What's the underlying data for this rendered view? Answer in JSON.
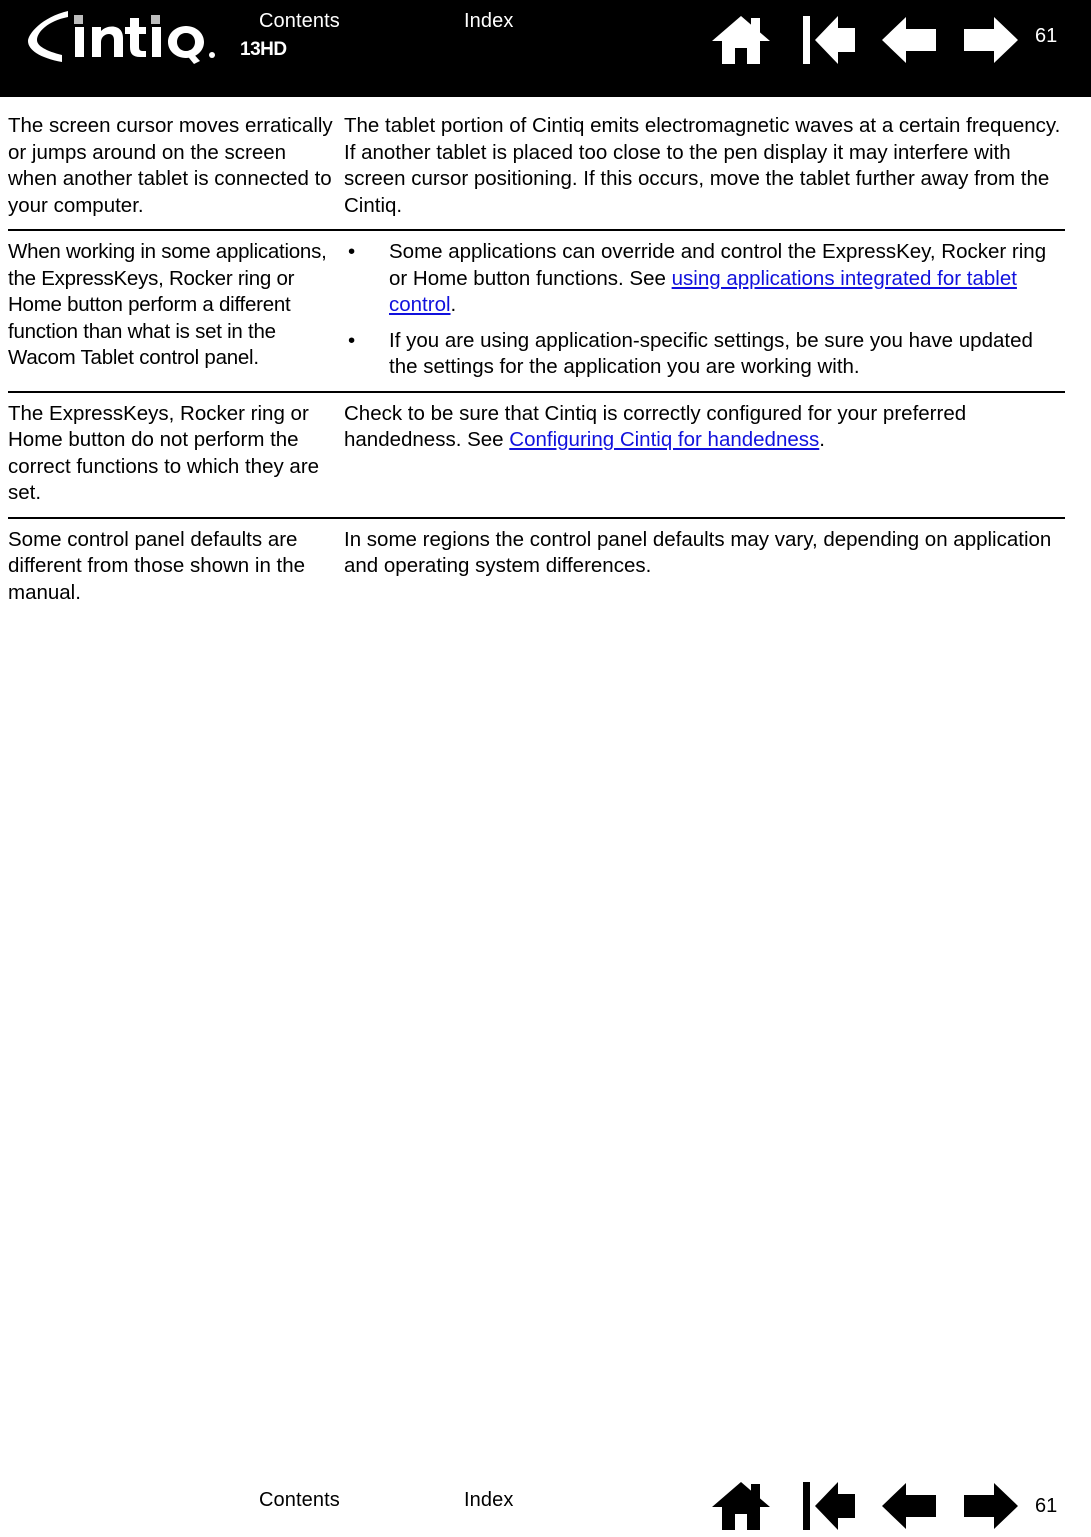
{
  "document": {
    "brand": "Cintiq",
    "model": "13HD",
    "page_number": "61"
  },
  "header": {
    "contents_label": "Contents",
    "index_label": "Index",
    "page_number": "61",
    "background_color": "#000000",
    "text_color": "#FFFFFF",
    "icons": [
      {
        "name": "home-icon",
        "label": "Home"
      },
      {
        "name": "first-page-icon",
        "label": "First page"
      },
      {
        "name": "previous-page-icon",
        "label": "Previous page"
      },
      {
        "name": "next-page-icon",
        "label": "Next page"
      }
    ]
  },
  "footer": {
    "contents_label": "Contents",
    "index_label": "Index",
    "page_number": "61",
    "background_color": "#FFFFFF",
    "text_color": "#000000",
    "icons": [
      {
        "name": "home-icon",
        "label": "Home"
      },
      {
        "name": "first-page-icon",
        "label": "First page"
      },
      {
        "name": "previous-page-icon",
        "label": "Previous page"
      },
      {
        "name": "next-page-icon",
        "label": "Next page"
      }
    ]
  },
  "link_color": "#1111DD",
  "table": {
    "rows": [
      {
        "symptom": "The screen cursor moves erratically or jumps around on the screen when another tablet is connected to your computer.",
        "solution_type": "paragraph",
        "solution": "The tablet portion of Cintiq emits electromagnetic waves at a certain frequency. If another tablet is placed too close to the pen display it may interfere with screen cursor positioning. If this occurs, move the tablet further away from the Cintiq."
      },
      {
        "symptom": "When working in some applications, the ExpressKeys, Rocker ring or Home button perform a different function than what is set in the Wacom Tablet control panel.",
        "solution_type": "bullets",
        "bullets": [
          {
            "bullet": "•",
            "text_before": "Some applications can override and control the ExpressKey, Rocker ring or Home button functions. See ",
            "link": "using applications integrated for tablet control",
            "text_after": "."
          },
          {
            "bullet": "•",
            "text_before": "If you are using application-specific settings, be sure you have updated the settings for the application you are working with.",
            "link": "",
            "text_after": ""
          }
        ]
      },
      {
        "symptom": "The ExpressKeys, Rocker ring or Home button do not perform the correct functions to which they are set.",
        "solution_type": "paragraph_with_link",
        "text_before": "Check to be sure that Cintiq is correctly configured for your preferred handedness. See ",
        "link": "Configuring Cintiq for handedness",
        "text_after": "."
      },
      {
        "symptom": "Some control panel defaults are different from those shown in the manual.",
        "solution_type": "paragraph",
        "solution": "In some regions the control panel defaults may vary, depending on application and operating system differences."
      }
    ]
  }
}
